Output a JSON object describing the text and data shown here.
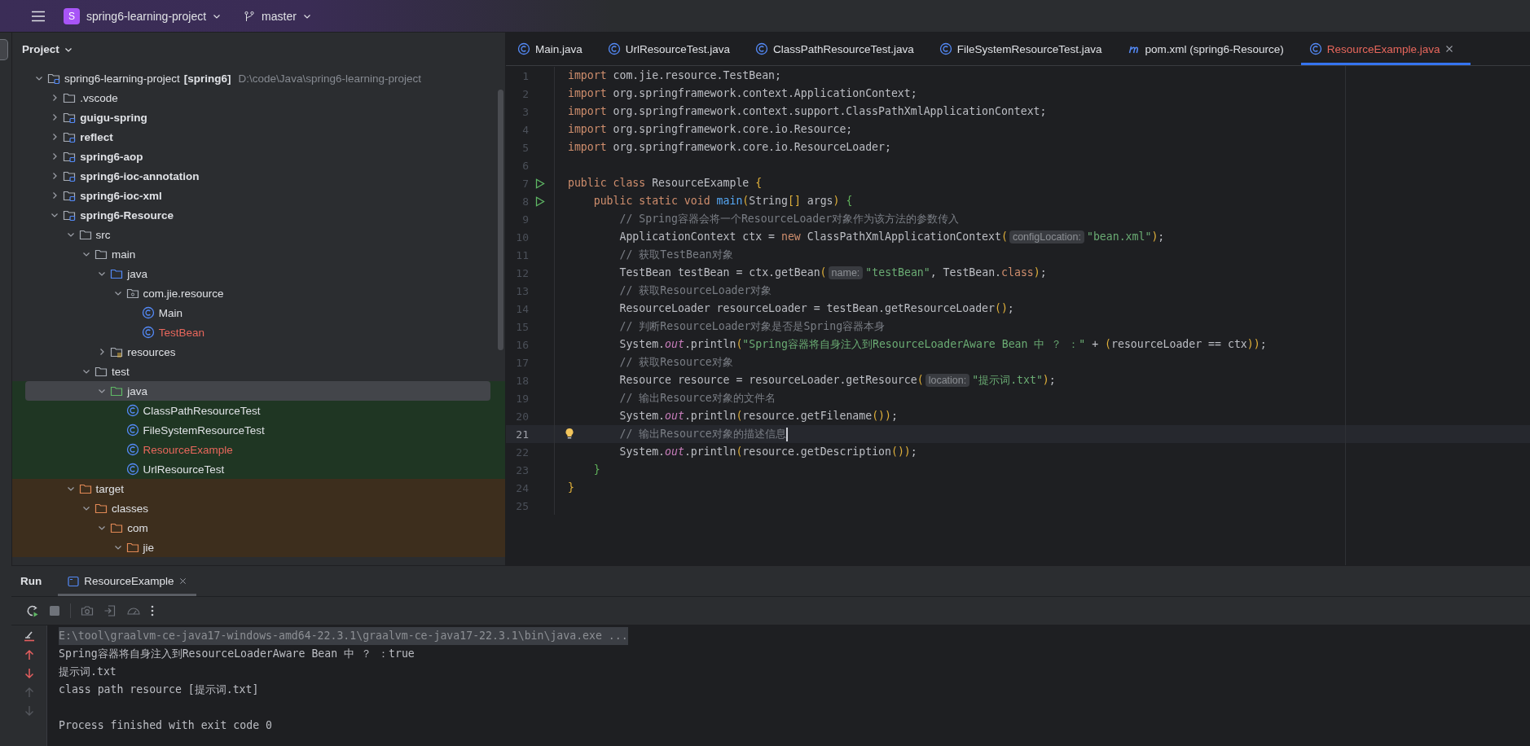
{
  "top_bar": {
    "project_badge": "S",
    "project_name": "spring6-learning-project",
    "branch": "master"
  },
  "project_panel": {
    "title": "Project",
    "tree": [
      {
        "kind": "project",
        "label": "spring6-learning-project",
        "module": "[spring6]",
        "path": "D:\\code\\Java\\spring6-learning-project",
        "expanded": true,
        "selected": false,
        "children": [
          {
            "kind": "folder",
            "label": ".vscode",
            "expanded": false,
            "selected": false
          },
          {
            "kind": "module",
            "label": "guigu-spring",
            "expanded": false,
            "selected": false
          },
          {
            "kind": "module",
            "label": "reflect",
            "expanded": false,
            "selected": false
          },
          {
            "kind": "module",
            "label": "spring6-aop",
            "expanded": false,
            "selected": false
          },
          {
            "kind": "module",
            "label": "spring6-ioc-annotation",
            "expanded": false,
            "selected": false
          },
          {
            "kind": "module",
            "label": "spring6-ioc-xml",
            "expanded": false,
            "selected": false
          },
          {
            "kind": "module",
            "label": "spring6-Resource",
            "expanded": true,
            "selected": false,
            "children": [
              {
                "kind": "folder",
                "label": "src",
                "expanded": true,
                "selected": false,
                "children": [
                  {
                    "kind": "folder",
                    "label": "main",
                    "expanded": true,
                    "selected": false,
                    "children": [
                      {
                        "kind": "source-root",
                        "label": "java",
                        "expanded": true,
                        "selected": false,
                        "children": [
                          {
                            "kind": "package",
                            "label": "com.jie.resource",
                            "expanded": true,
                            "selected": false,
                            "children": [
                              {
                                "kind": "class",
                                "label": "Main",
                                "unversioned": false,
                                "selected": false
                              },
                              {
                                "kind": "class",
                                "label": "TestBean",
                                "unversioned": true,
                                "selected": false
                              }
                            ]
                          }
                        ]
                      },
                      {
                        "kind": "resources-root",
                        "label": "resources",
                        "expanded": false,
                        "selected": false
                      }
                    ]
                  },
                  {
                    "kind": "folder",
                    "label": "test",
                    "expanded": true,
                    "selected": false,
                    "children": [
                      {
                        "kind": "test-root",
                        "label": "java",
                        "expanded": true,
                        "selected": true,
                        "children": [
                          {
                            "kind": "class",
                            "label": "ClassPathResourceTest",
                            "unversioned": false,
                            "selected": false
                          },
                          {
                            "kind": "class",
                            "label": "FileSystemResourceTest",
                            "unversioned": false,
                            "selected": false
                          },
                          {
                            "kind": "class",
                            "label": "ResourceExample",
                            "unversioned": true,
                            "selected": false
                          },
                          {
                            "kind": "class",
                            "label": "UrlResourceTest",
                            "unversioned": false,
                            "selected": false
                          }
                        ]
                      }
                    ]
                  }
                ]
              },
              {
                "kind": "excluded",
                "label": "target",
                "expanded": true,
                "selected": false,
                "children": [
                  {
                    "kind": "excluded",
                    "label": "classes",
                    "expanded": true,
                    "selected": false,
                    "children": [
                      {
                        "kind": "excluded",
                        "label": "com",
                        "expanded": true,
                        "selected": false,
                        "children": [
                          {
                            "kind": "excluded",
                            "label": "jie",
                            "expanded": true,
                            "selected": false
                          }
                        ]
                      }
                    ]
                  }
                ]
              }
            ]
          }
        ]
      }
    ]
  },
  "editor": {
    "tabs": [
      {
        "kind": "class",
        "label": "Main.java",
        "unversioned": false,
        "selected": false
      },
      {
        "kind": "class",
        "label": "UrlResourceTest.java",
        "unversioned": false,
        "selected": false
      },
      {
        "kind": "class",
        "label": "ClassPathResourceTest.java",
        "unversioned": false,
        "selected": false
      },
      {
        "kind": "class",
        "label": "FileSystemResourceTest.java",
        "unversioned": false,
        "selected": false
      },
      {
        "kind": "maven",
        "label": "pom.xml (spring6-Resource)",
        "unversioned": false,
        "selected": false
      },
      {
        "kind": "class",
        "label": "ResourceExample.java",
        "unversioned": true,
        "selected": true
      }
    ],
    "lines": [
      {
        "number": "1",
        "runnable": false,
        "intention": false,
        "current": false,
        "tokens": [
          {
            "kind": "keyword",
            "text": "import "
          },
          {
            "kind": "plain",
            "text": "com.jie.resource.TestBean;"
          }
        ]
      },
      {
        "number": "2",
        "runnable": false,
        "intention": false,
        "current": false,
        "tokens": [
          {
            "kind": "keyword",
            "text": "import "
          },
          {
            "kind": "plain",
            "text": "org.springframework.context.ApplicationContext;"
          }
        ]
      },
      {
        "number": "3",
        "runnable": false,
        "intention": false,
        "current": false,
        "tokens": [
          {
            "kind": "keyword",
            "text": "import "
          },
          {
            "kind": "plain",
            "text": "org.springframework.context.support.ClassPathXmlApplicationContext;"
          }
        ]
      },
      {
        "number": "4",
        "runnable": false,
        "intention": false,
        "current": false,
        "tokens": [
          {
            "kind": "keyword",
            "text": "import "
          },
          {
            "kind": "plain",
            "text": "org.springframework.core.io.Resource;"
          }
        ]
      },
      {
        "number": "5",
        "runnable": false,
        "intention": false,
        "current": false,
        "tokens": [
          {
            "kind": "keyword",
            "text": "import "
          },
          {
            "kind": "plain",
            "text": "org.springframework.core.io.ResourceLoader;"
          }
        ]
      },
      {
        "number": "6",
        "runnable": false,
        "intention": false,
        "current": false
      },
      {
        "number": "7",
        "runnable": true,
        "intention": false,
        "current": false,
        "tokens": [
          {
            "kind": "keyword",
            "text": "public class "
          },
          {
            "kind": "plain",
            "text": "ResourceExample "
          },
          {
            "kind": "paren",
            "text": "{"
          }
        ]
      },
      {
        "number": "8",
        "runnable": true,
        "intention": false,
        "current": false,
        "tokens": [
          {
            "kind": "keyword",
            "text": "    public static void "
          },
          {
            "kind": "method",
            "text": "main"
          },
          {
            "kind": "paren",
            "text": "("
          },
          {
            "kind": "plain",
            "text": "String"
          },
          {
            "kind": "paren",
            "text": "[]"
          },
          {
            "kind": "plain",
            "text": " args"
          },
          {
            "kind": "paren",
            "text": ")"
          },
          {
            "kind": "brace",
            "text": " {"
          }
        ]
      },
      {
        "number": "9",
        "runnable": false,
        "intention": false,
        "current": false,
        "tokens": [
          {
            "kind": "comment",
            "text": "        // Spring容器会将一个ResourceLoader对象作为该方法的参数传入"
          }
        ]
      },
      {
        "number": "10",
        "runnable": false,
        "intention": false,
        "current": false,
        "tokens": [
          {
            "kind": "plain",
            "text": "        ApplicationContext ctx = "
          },
          {
            "kind": "keyword",
            "text": "new "
          },
          {
            "kind": "plain",
            "text": "ClassPathXmlApplicationContext"
          },
          {
            "kind": "paren",
            "text": "("
          },
          {
            "kind": "hint",
            "text": "configLocation:"
          },
          {
            "kind": "string",
            "text": "\"bean.xml\""
          },
          {
            "kind": "paren",
            "text": ")"
          },
          {
            "kind": "plain",
            "text": ";"
          }
        ]
      },
      {
        "number": "11",
        "runnable": false,
        "intention": false,
        "current": false,
        "tokens": [
          {
            "kind": "comment",
            "text": "        // 获取TestBean对象"
          }
        ]
      },
      {
        "number": "12",
        "runnable": false,
        "intention": false,
        "current": false,
        "tokens": [
          {
            "kind": "plain",
            "text": "        TestBean testBean = ctx.getBean"
          },
          {
            "kind": "paren",
            "text": "("
          },
          {
            "kind": "hint",
            "text": "name:"
          },
          {
            "kind": "string",
            "text": "\"testBean\""
          },
          {
            "kind": "plain",
            "text": ", TestBean."
          },
          {
            "kind": "keyword",
            "text": "class"
          },
          {
            "kind": "paren",
            "text": ")"
          },
          {
            "kind": "plain",
            "text": ";"
          }
        ]
      },
      {
        "number": "13",
        "runnable": false,
        "intention": false,
        "current": false,
        "tokens": [
          {
            "kind": "comment",
            "text": "        // 获取ResourceLoader对象"
          }
        ]
      },
      {
        "number": "14",
        "runnable": false,
        "intention": false,
        "current": false,
        "tokens": [
          {
            "kind": "plain",
            "text": "        ResourceLoader resourceLoader = testBean.getResourceLoader"
          },
          {
            "kind": "paren",
            "text": "()"
          },
          {
            "kind": "plain",
            "text": ";"
          }
        ]
      },
      {
        "number": "15",
        "runnable": false,
        "intention": false,
        "current": false,
        "tokens": [
          {
            "kind": "comment",
            "text": "        // 判断ResourceLoader对象是否是Spring容器本身"
          }
        ]
      },
      {
        "number": "16",
        "runnable": false,
        "intention": false,
        "current": false,
        "tokens": [
          {
            "kind": "plain",
            "text": "        System."
          },
          {
            "kind": "field",
            "text": "out"
          },
          {
            "kind": "plain",
            "text": ".println"
          },
          {
            "kind": "paren",
            "text": "("
          },
          {
            "kind": "string",
            "text": "\"Spring容器将自身注入到ResourceLoaderAware Bean 中 ？ ：\""
          },
          {
            "kind": "plain",
            "text": " + "
          },
          {
            "kind": "paren",
            "text": "("
          },
          {
            "kind": "plain",
            "text": "resourceLoader == ctx"
          },
          {
            "kind": "paren",
            "text": "))"
          },
          {
            "kind": "plain",
            "text": ";"
          }
        ]
      },
      {
        "number": "17",
        "runnable": false,
        "intention": false,
        "current": false,
        "tokens": [
          {
            "kind": "comment",
            "text": "        // 获取Resource对象"
          }
        ]
      },
      {
        "number": "18",
        "runnable": false,
        "intention": false,
        "current": false,
        "tokens": [
          {
            "kind": "plain",
            "text": "        Resource resource = resourceLoader.getResource"
          },
          {
            "kind": "paren",
            "text": "("
          },
          {
            "kind": "hint",
            "text": "location:"
          },
          {
            "kind": "string",
            "text": "\"提示词.txt\""
          },
          {
            "kind": "paren",
            "text": ")"
          },
          {
            "kind": "plain",
            "text": ";"
          }
        ]
      },
      {
        "number": "19",
        "runnable": false,
        "intention": false,
        "current": false,
        "tokens": [
          {
            "kind": "comment",
            "text": "        // 输出Resource对象的文件名"
          }
        ]
      },
      {
        "number": "20",
        "runnable": false,
        "intention": false,
        "current": false,
        "tokens": [
          {
            "kind": "plain",
            "text": "        System."
          },
          {
            "kind": "field",
            "text": "out"
          },
          {
            "kind": "plain",
            "text": ".println"
          },
          {
            "kind": "paren",
            "text": "("
          },
          {
            "kind": "plain",
            "text": "resource.getFilename"
          },
          {
            "kind": "paren",
            "text": "())"
          },
          {
            "kind": "plain",
            "text": ";"
          }
        ]
      },
      {
        "number": "21",
        "runnable": false,
        "intention": true,
        "current": true,
        "tokens": [
          {
            "kind": "comment",
            "text": "        // 输出Resource对象的描述信息"
          }
        ]
      },
      {
        "number": "22",
        "runnable": false,
        "intention": false,
        "current": false,
        "tokens": [
          {
            "kind": "plain",
            "text": "        System."
          },
          {
            "kind": "field",
            "text": "out"
          },
          {
            "kind": "plain",
            "text": ".println"
          },
          {
            "kind": "paren",
            "text": "("
          },
          {
            "kind": "plain",
            "text": "resource.getDescription"
          },
          {
            "kind": "paren",
            "text": "())"
          },
          {
            "kind": "plain",
            "text": ";"
          }
        ]
      },
      {
        "number": "23",
        "runnable": false,
        "intention": false,
        "current": false,
        "tokens": [
          {
            "kind": "brace",
            "text": "    }"
          }
        ]
      },
      {
        "number": "24",
        "runnable": false,
        "intention": false,
        "current": false,
        "tokens": [
          {
            "kind": "paren",
            "text": "}"
          }
        ]
      },
      {
        "number": "25",
        "runnable": false,
        "intention": false,
        "current": false
      }
    ]
  },
  "run_panel": {
    "title": "Run",
    "tabs": [
      {
        "label": "ResourceExample",
        "selected": true
      }
    ],
    "console": [
      {
        "kind": "command",
        "text": "E:\\tool\\graalvm-ce-java17-windows-amd64-22.3.1\\graalvm-ce-java17-22.3.1\\bin\\java.exe ..."
      },
      {
        "kind": "output",
        "text": "Spring容器将自身注入到ResourceLoaderAware Bean 中 ？ ：true"
      },
      {
        "kind": "output",
        "text": "提示词.txt"
      },
      {
        "kind": "output",
        "text": "class path resource [提示词.txt]"
      },
      {
        "kind": "exit",
        "text": "Process finished with exit code 0"
      }
    ]
  }
}
